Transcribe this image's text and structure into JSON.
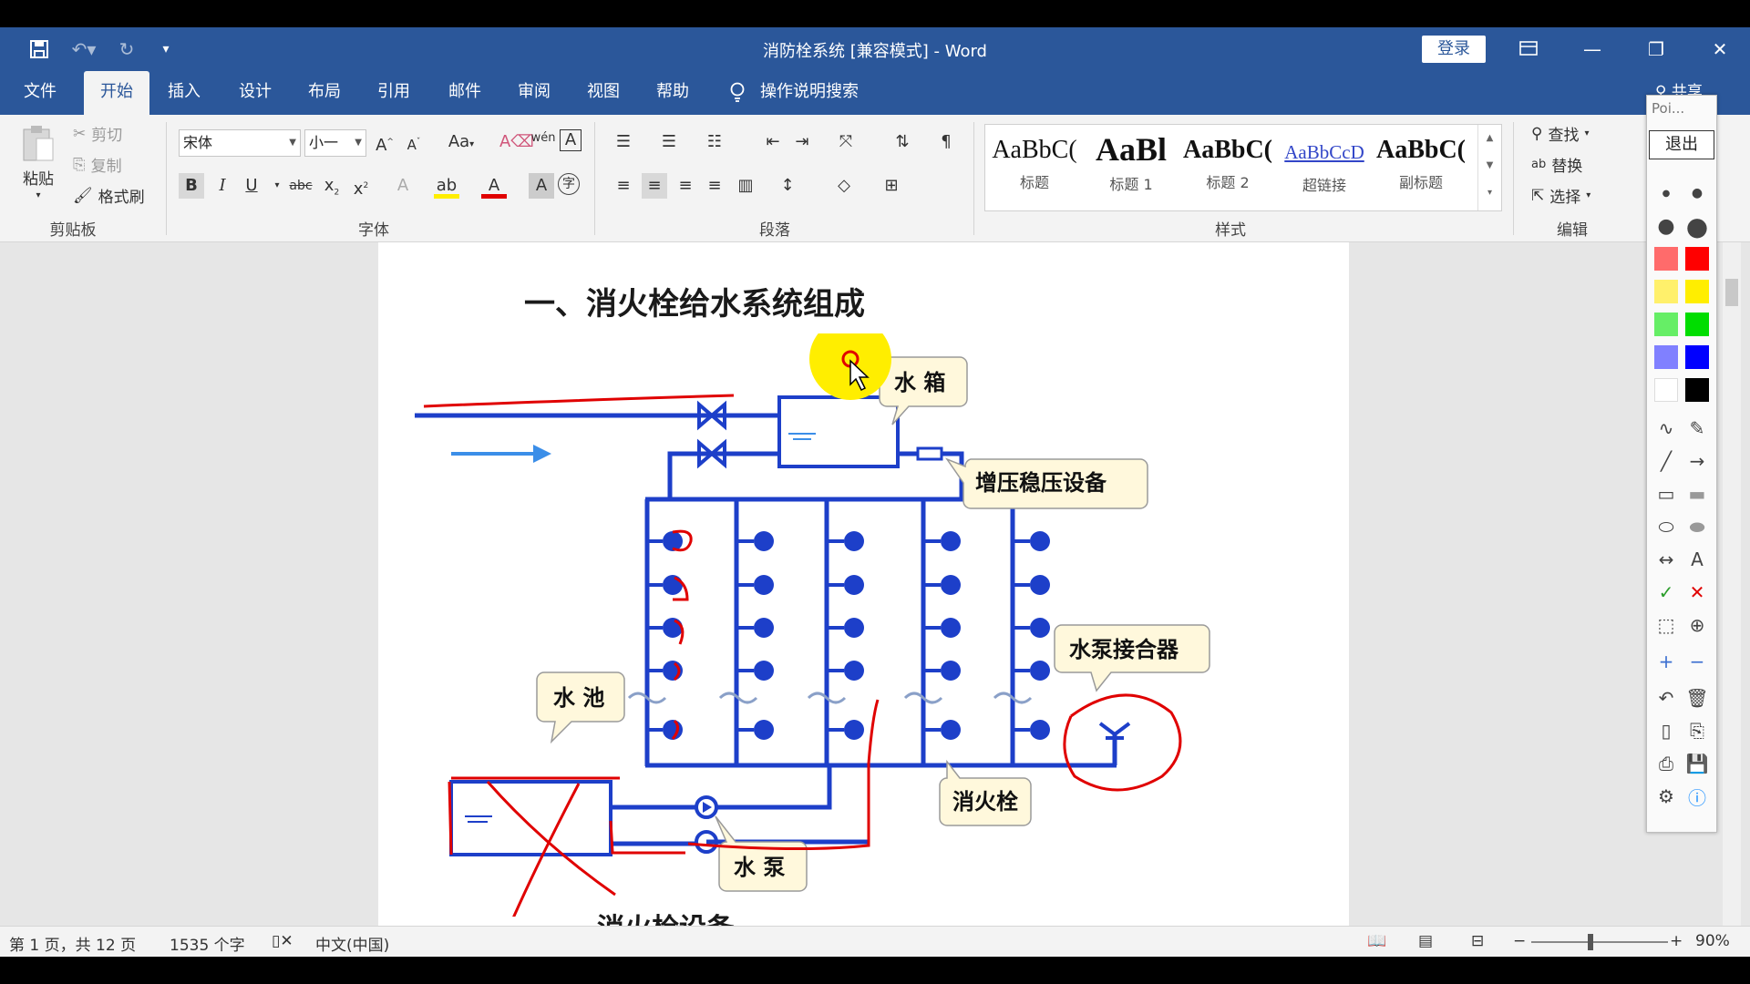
{
  "title_bar": {
    "doc_title": "消防栓系统 [兼容模式]  -  Word",
    "login_label": "登录",
    "qa_save_icon": "save-icon",
    "qa_undo_icon": "undo-icon",
    "qa_redo_icon": "redo-icon"
  },
  "tabs": [
    "文件",
    "开始",
    "插入",
    "设计",
    "布局",
    "引用",
    "邮件",
    "审阅",
    "视图",
    "帮助"
  ],
  "tell_me": "操作说明搜索",
  "share": "共享",
  "ribbon": {
    "clipboard": {
      "paste": "粘贴",
      "cut": "剪切",
      "copy": "复制",
      "format_painter": "格式刷",
      "label": "剪贴板"
    },
    "font": {
      "name": "宋体",
      "size": "小一",
      "label": "字体",
      "case": "Aa",
      "pinyin": "wén"
    },
    "paragraph": {
      "label": "段落"
    },
    "styles": {
      "label": "样式",
      "items": [
        {
          "preview": "AaBbC(",
          "name": "标题"
        },
        {
          "preview": "AaBl",
          "name": "标题 1"
        },
        {
          "preview": "AaBbC(",
          "name": "标题 2"
        },
        {
          "preview": "AaBbCcD",
          "name": "超链接"
        },
        {
          "preview": "AaBbC(",
          "name": "副标题"
        }
      ]
    },
    "editing": {
      "find": "查找",
      "replace": "替换",
      "select": "选择",
      "label": "编辑"
    }
  },
  "document": {
    "heading": "一、消火栓给水系统组成",
    "heading_next": "消火栓设备",
    "callouts": {
      "tank": "水 箱",
      "booster": "增压稳压设备",
      "pump_connector": "水泵接合器",
      "pool": "水 池",
      "hydrant": "消火栓",
      "pump": "水 泵"
    }
  },
  "status": {
    "page": "第 1 页，共 12 页",
    "words": "1535 个字",
    "lang": "中文(中国)",
    "zoom": "90%"
  },
  "pen_toolbar": {
    "title": "Poi...",
    "exit": "退出",
    "colors": [
      "#ff6b6b",
      "#ff0000",
      "#fff06b",
      "#ffee00",
      "#66ee66",
      "#00dd00",
      "#8080ff",
      "#0000ff",
      "#ffffff",
      "#000000"
    ]
  },
  "colors": {
    "word_blue": "#2b579a",
    "pipe_blue": "#1d3fc9",
    "ink_red": "#e00000",
    "highlight": "#ffee00"
  }
}
